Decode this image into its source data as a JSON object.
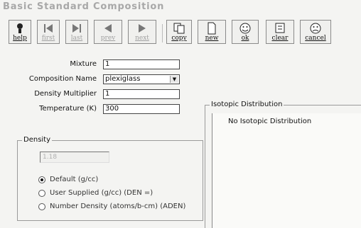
{
  "window": {
    "title": "Basic Standard Composition"
  },
  "toolbar": {
    "buttons": [
      {
        "label": "help",
        "icon": "help-icon",
        "enabled": true
      },
      {
        "label": "first",
        "icon": "first-icon",
        "enabled": false
      },
      {
        "label": "last",
        "icon": "last-icon",
        "enabled": false
      },
      {
        "label": "prev",
        "icon": "prev-icon",
        "enabled": false
      },
      {
        "label": "next",
        "icon": "next-icon",
        "enabled": false
      },
      {
        "label": "copy",
        "icon": "copy-icon",
        "enabled": true
      },
      {
        "label": "new",
        "icon": "new-icon",
        "enabled": true
      },
      {
        "label": "ok",
        "icon": "ok-icon",
        "enabled": true
      },
      {
        "label": "clear",
        "icon": "clear-icon",
        "enabled": true
      },
      {
        "label": "cancel",
        "icon": "cancel-icon",
        "enabled": true
      }
    ]
  },
  "form": {
    "mixture_label": "Mixture",
    "mixture_value": "1",
    "composition_label": "Composition Name",
    "composition_value": "plexiglass",
    "density_mult_label": "Density Multiplier",
    "density_mult_value": "1",
    "temperature_label": "Temperature (K)",
    "temperature_value": "300"
  },
  "density": {
    "group_title": "Density",
    "value": "1.18",
    "options": [
      {
        "label": "Default (g/cc)",
        "selected": true
      },
      {
        "label": "User Supplied (g/cc) (DEN =)",
        "selected": false
      },
      {
        "label": "Number Density (atoms/b-cm)  (ADEN)",
        "selected": false
      }
    ]
  },
  "isotopic": {
    "group_title": "Isotopic Distribution",
    "items": [
      "No Isotopic Distribution"
    ]
  }
}
